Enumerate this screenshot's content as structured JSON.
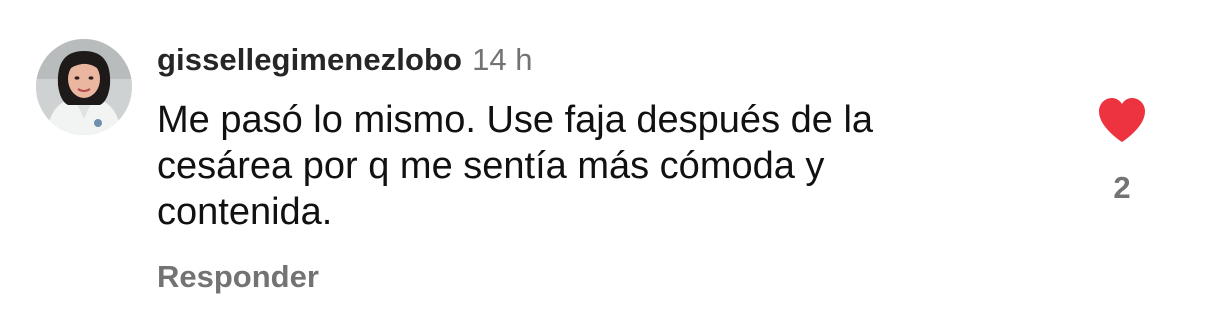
{
  "comment": {
    "avatar_icon": "user-avatar-photo",
    "username": "gissellegimenezlobo",
    "timestamp": "14 h",
    "text": "Me pasó lo mismo. Use faja después de la\ncesárea por q me sentía más cómoda y\ncontenida.",
    "reply_label": "Responder",
    "like_icon": "heart-filled-icon",
    "like_color": "#ee3340",
    "like_count": "2",
    "liked": true
  }
}
